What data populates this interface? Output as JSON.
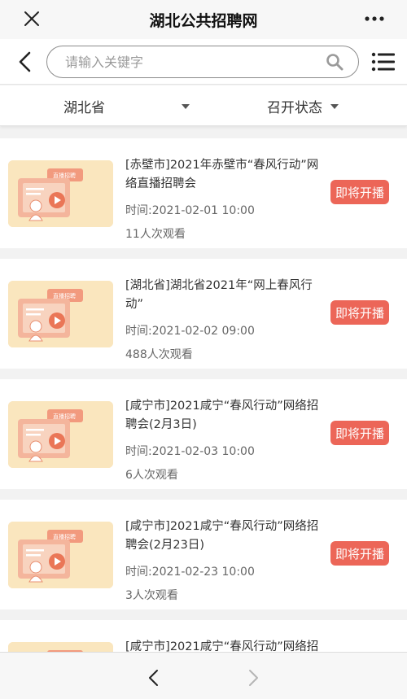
{
  "app": {
    "title": "湖北公共招聘网"
  },
  "search": {
    "placeholder": "请输入关键字",
    "value": ""
  },
  "filters": {
    "region": "湖北省",
    "status": "召开状态"
  },
  "events": [
    {
      "title": "[赤壁市]2021年赤壁市“春风行动”网络直播招聘会",
      "time": "时间:2021-02-01 10:00",
      "views": "11人次观看",
      "badge": "即将开播",
      "thumb_badge": "直播招聘"
    },
    {
      "title": "[湖北省]湖北省2021年“网上春风行动”",
      "time": "时间:2021-02-02 09:00",
      "views": "488人次观看",
      "badge": "即将开播",
      "thumb_badge": "直播招聘"
    },
    {
      "title": "[咸宁市]2021咸宁“春风行动”网络招聘会(2月3日)",
      "time": "时间:2021-02-03 10:00",
      "views": "6人次观看",
      "badge": "即将开播",
      "thumb_badge": "直播招聘"
    },
    {
      "title": "[咸宁市]2021咸宁“春风行动”网络招聘会(2月23日)",
      "time": "时间:2021-02-23 10:00",
      "views": "3人次观看",
      "badge": "即将开播",
      "thumb_badge": "直播招聘"
    },
    {
      "title": "[咸宁市]2021咸宁“春风行动”网络招"
    }
  ],
  "icons": {
    "close": "close-icon",
    "more": "more-icon",
    "back": "chevron-left-icon",
    "search": "search-icon",
    "menu": "list-menu-icon",
    "nav_back": "nav-back-icon",
    "nav_forward": "nav-forward-icon"
  },
  "colors": {
    "badge": "#ec6658",
    "thumb_bg": "#fae6be"
  }
}
